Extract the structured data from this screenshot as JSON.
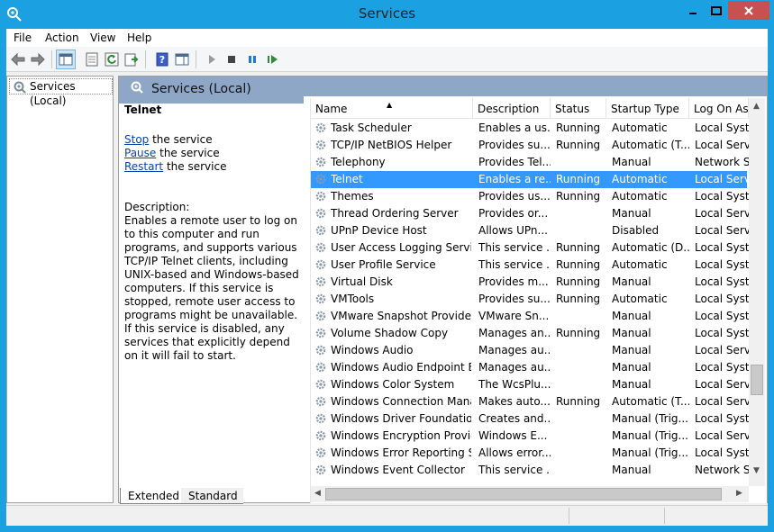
{
  "window": {
    "title": "Services"
  },
  "menu": [
    "File",
    "Action",
    "View",
    "Help"
  ],
  "tree": {
    "root_label": "Services (Local)"
  },
  "panel": {
    "title": "Services (Local)"
  },
  "details": {
    "service_name": "Telnet",
    "actions": [
      {
        "link": "Stop",
        "rest": " the service"
      },
      {
        "link": "Pause",
        "rest": " the service"
      },
      {
        "link": "Restart",
        "rest": " the service"
      }
    ],
    "description_label": "Description:",
    "description_text": "Enables a remote user to log on to this computer and run programs, and supports various TCP/IP Telnet clients, including UNIX-based and Windows-based computers. If this service is stopped, remote user access to programs might be unavailable. If this service is disabled, any services that explicitly depend on it will fail to start."
  },
  "columns": [
    "Name",
    "Description",
    "Status",
    "Startup Type",
    "Log On As"
  ],
  "services": [
    [
      "Task Scheduler",
      "Enables a us...",
      "Running",
      "Automatic",
      "Local Syste..."
    ],
    [
      "TCP/IP NetBIOS Helper",
      "Provides su...",
      "Running",
      "Automatic (T...",
      "Local Servic"
    ],
    [
      "Telephony",
      "Provides Tel...",
      "",
      "Manual",
      "Network S..."
    ],
    [
      "Telnet",
      "Enables a re...",
      "Running",
      "Automatic",
      "Local Servic"
    ],
    [
      "Themes",
      "Provides us...",
      "Running",
      "Automatic",
      "Local Syste..."
    ],
    [
      "Thread Ordering Server",
      "Provides or...",
      "",
      "Manual",
      "Local Servic"
    ],
    [
      "UPnP Device Host",
      "Allows UPn...",
      "",
      "Disabled",
      "Local Servic"
    ],
    [
      "User Access Logging Service",
      "This service ...",
      "Running",
      "Automatic (D...",
      "Local Syste..."
    ],
    [
      "User Profile Service",
      "This service ...",
      "Running",
      "Automatic",
      "Local Syste..."
    ],
    [
      "Virtual Disk",
      "Provides m...",
      "Running",
      "Manual",
      "Local Syste..."
    ],
    [
      "VMTools",
      "Provides su...",
      "Running",
      "Automatic",
      "Local Syste..."
    ],
    [
      "VMware Snapshot Provider",
      "VMware Sn...",
      "",
      "Manual",
      "Local Syste..."
    ],
    [
      "Volume Shadow Copy",
      "Manages an...",
      "Running",
      "Manual",
      "Local Syste..."
    ],
    [
      "Windows Audio",
      "Manages au...",
      "",
      "Manual",
      "Local Servic"
    ],
    [
      "Windows Audio Endpoint B...",
      "Manages au...",
      "",
      "Manual",
      "Local Syste..."
    ],
    [
      "Windows Color System",
      "The WcsPlu...",
      "",
      "Manual",
      "Local Servic"
    ],
    [
      "Windows Connection Mana...",
      "Makes auto...",
      "Running",
      "Automatic (T...",
      "Local Servic"
    ],
    [
      "Windows Driver Foundation...",
      "Creates and...",
      "",
      "Manual (Trig...",
      "Local Syste..."
    ],
    [
      "Windows Encryption Provid...",
      "Windows E...",
      "",
      "Manual (Trig...",
      "Local Servic"
    ],
    [
      "Windows Error Reporting Se...",
      "Allows error...",
      "",
      "Manual (Trig...",
      "Local Syste..."
    ],
    [
      "Windows Event Collector",
      "This service ...",
      "",
      "Manual",
      "Network S..."
    ]
  ],
  "selected_index": 3,
  "tabs": [
    "Extended",
    "Standard"
  ],
  "colors": {
    "titlebar": "#1ba1e2",
    "selection": "#3399ff",
    "panel_header": "#8fa7c7",
    "close_button": "#c75050"
  }
}
